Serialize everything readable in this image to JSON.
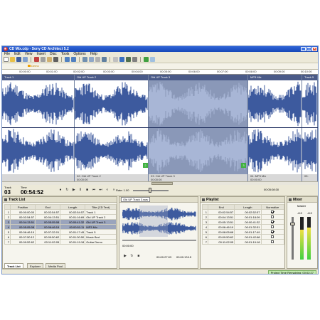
{
  "window": {
    "title": "CD Mix.cdp - Sony CD Architect 5.2"
  },
  "menu": [
    "File",
    "Edit",
    "View",
    "Insert",
    "Disc",
    "Tools",
    "Options",
    "Help"
  ],
  "marker": {
    "label": "Demo"
  },
  "ruler": [
    "00:00:00",
    "00:01:00",
    "00:02:00",
    "00:03:00",
    "00:04:00",
    "00:05:00",
    "00:06:00",
    "00:07:00",
    "00:08:00",
    "00:09:00",
    "00:10:00"
  ],
  "tracks": [
    {
      "header": "Track 1",
      "footer_top": "",
      "footer_bottom": ""
    },
    {
      "header": "Old UP Track 2",
      "footer_top": "02: Old UP Track 2",
      "footer_bottom": "00:00:00"
    },
    {
      "header": "Old UP Track 3",
      "footer_top": "03: Old UP Track 3",
      "footer_bottom": "00:00:00"
    },
    {
      "header": "MP3 Mix",
      "footer_top": "04: MP3 Mix",
      "footer_bottom": "00:00:00"
    },
    {
      "header": "Track 5",
      "footer_top": "05:",
      "footer_bottom": ""
    }
  ],
  "region_badges": [
    "2",
    "3"
  ],
  "transport": {
    "track_label": "Track",
    "track_number": "03",
    "time_label": "Time",
    "time_value": "00:54:52",
    "rate_label": "Rate: 1.00",
    "end_time": "00:05:08:30"
  },
  "track_list": {
    "title": "Track List",
    "columns": [
      "Position",
      "End",
      "Length",
      "Title (CD Text)"
    ],
    "rows": [
      [
        "1",
        "00:00:00:00",
        "00:02:54:57",
        "00:02:54:57",
        "Track 1"
      ],
      [
        "2",
        "00:02:54:57",
        "00:04:13:51",
        "00:01:16:69",
        "Old UP Track 2"
      ],
      [
        "3",
        "00:04:13:51",
        "00:05:05:08",
        "00:00:41:32",
        "Old UP Track 3"
      ],
      [
        "4",
        "00:05:05:08",
        "00:06:46:19",
        "00:00:51:11",
        "MP3 Mix"
      ],
      [
        "5",
        "00:06:46:19",
        "00:07:32:01",
        "00:01:17:49",
        "Track 5"
      ],
      [
        "6",
        "00:07:50:12",
        "00:09:50:62",
        "00:01:30:50",
        "Music Bed"
      ],
      [
        "7",
        "00:09:52:62",
        "00:11:02:05",
        "00:01:19:18",
        "Guitar Demo"
      ]
    ],
    "tabs": [
      "Track List",
      "Explorer",
      "Media Pool"
    ]
  },
  "editor": {
    "file": "Old UP Track 3.wav",
    "times": [
      "00:00:00",
      "00:00:27:03",
      "00:00:13:15"
    ]
  },
  "playlist": {
    "title": "Playlist",
    "columns": [
      "End",
      "Length",
      "Normalize"
    ],
    "rows": [
      [
        "1",
        "00:02:54:57",
        "00:02:52:57",
        true
      ],
      [
        "2",
        "00:04:13:51",
        "00:01:18:09",
        false
      ],
      [
        "3",
        "00:05:13:51",
        "00:00:41:32",
        true
      ],
      [
        "4",
        "00:06:46:19",
        "00:01:32:51",
        false
      ],
      [
        "5",
        "00:08:05:68",
        "00:01:17:49",
        true
      ],
      [
        "6",
        "00:09:50:62",
        "00:01:42:68",
        false
      ],
      [
        "7",
        "00:11:02:05",
        "00:01:19:18",
        false
      ]
    ]
  },
  "mixer": {
    "title": "Mixer",
    "master_label": "Master",
    "left_db": "-8.0",
    "right_db": "-8.0",
    "level_left": 0.7,
    "level_right": 0.75
  },
  "status": {
    "text": "Project Time Remaining: 00:02:27"
  },
  "colors": {
    "wave_main": "#3d5a9e",
    "wave_selected": "#a8b6d6",
    "track_header": "#4a5a88",
    "title_bar": "#2458c8",
    "status_green": "#c4ecb0"
  }
}
